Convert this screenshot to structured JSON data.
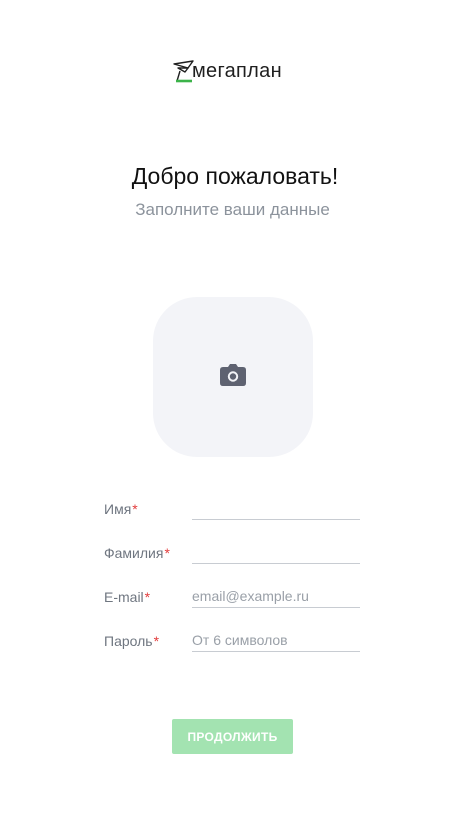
{
  "logo": {
    "text": "мегаплан",
    "icon": "paper-plane-icon",
    "accent_color": "#3cb34a"
  },
  "welcome": {
    "title": "Добро пожаловать!",
    "subtitle": "Заполните ваши данные"
  },
  "photo_upload": {
    "icon": "camera-icon"
  },
  "form": {
    "required_mark": "*",
    "first_name": {
      "label": "Имя",
      "value": "",
      "placeholder": ""
    },
    "last_name": {
      "label": "Фамилия",
      "value": "",
      "placeholder": ""
    },
    "email": {
      "label": "E-mail",
      "value": "",
      "placeholder": "email@example.ru"
    },
    "password": {
      "label": "Пароль",
      "value": "",
      "placeholder": "От 6 символов"
    }
  },
  "actions": {
    "continue_label": "ПРОДОЛЖИТЬ",
    "continue_color": "#a3e3b1"
  }
}
